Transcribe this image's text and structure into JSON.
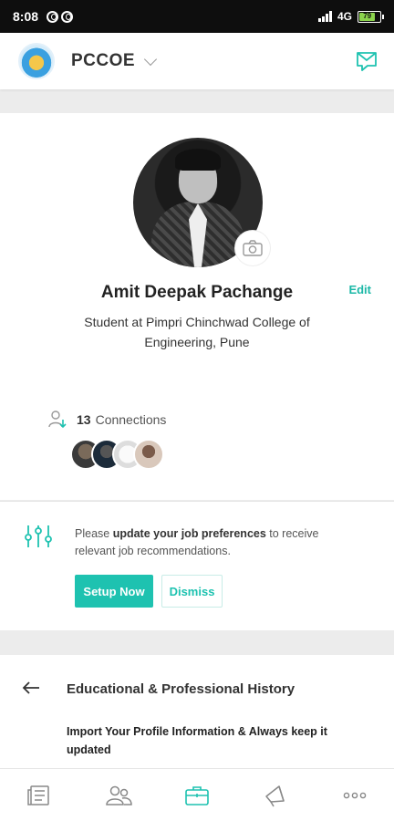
{
  "status_bar": {
    "time": "8:08",
    "network": "4G",
    "battery": "79"
  },
  "header": {
    "org_name": "PCCOE",
    "logo_icon": "college-logo",
    "messages_icon": "chat-icon"
  },
  "profile": {
    "name": "Amit Deepak Pachange",
    "headline": "Student at Pimpri Chinchwad College of Engineering, Pune",
    "edit_label": "Edit",
    "connections_count": "13",
    "connections_label": "Connections",
    "photo_icon": "camera-icon"
  },
  "job_prefs": {
    "text_lead": "Please ",
    "text_bold": "update your job preferences",
    "text_tail": " to receive relevant job recommendations.",
    "setup_label": "Setup Now",
    "dismiss_label": "Dismiss"
  },
  "history": {
    "title": "Educational & Professional History",
    "subtitle": "Import Your Profile Information & Always keep it updated"
  },
  "nav": [
    "feed-icon",
    "people-icon",
    "jobs-briefcase-icon",
    "announcements-icon",
    "more-icon"
  ],
  "colors": {
    "accent": "#1ec2b0",
    "accent_text": "#1cb8a7"
  }
}
